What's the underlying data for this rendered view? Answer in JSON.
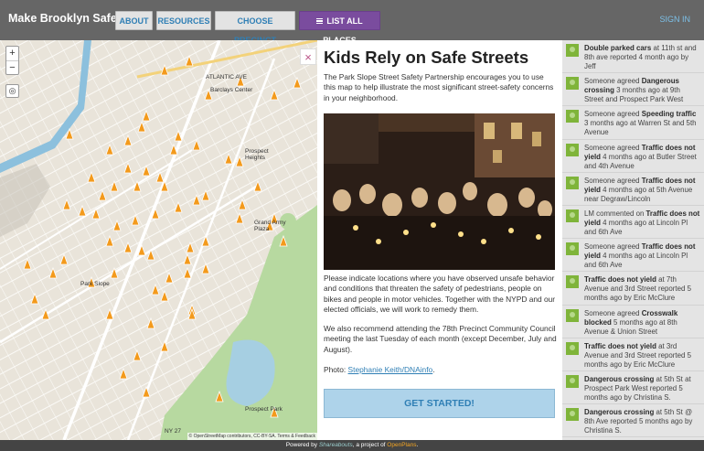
{
  "header": {
    "brand": "Make Brooklyn Safer",
    "nav": [
      "ABOUT",
      "RESOURCES",
      "CHOOSE PRECINCT",
      "LIST ALL PLACES"
    ],
    "signin": "SIGN IN"
  },
  "map": {
    "zoom_in": "+",
    "zoom_out": "−",
    "labels": [
      "ATLANTIC AVE",
      "Barclays Center",
      "Prospect Heights",
      "Grand Army Plaza",
      "Park Slope",
      "Prospect Park",
      "NY 27"
    ],
    "attribution": "© OpenStreetMap contributors, CC-BY-SA. Terms & Feedback"
  },
  "panel": {
    "close": "×",
    "title": "Kids Rely on Safe Streets",
    "intro": "The Park Slope Street Safety Partnership encourages you to use this map to help illustrate the most significant street-safety concerns in your neighborhood.",
    "body": "Please indicate locations where you have observed unsafe behavior and conditions that threaten the safety of pedestrians, people on bikes and people in motor vehicles. Together with the NYPD and our elected officials, we will work to remedy them.",
    "meeting": "We also recommend attending the 78th Precinct Community Council meeting the last Tuesday of each month (except December, July and August).",
    "photo_prefix": "Photo: ",
    "photo_credit": "Stephanie Keith/DNAinfo",
    "photo_suffix": ".",
    "cta": "GET STARTED!"
  },
  "activity": [
    {
      "bold1": "Double parked cars",
      "text1": " at 11th st and 8th ave reported 4 month ago by Jeff"
    },
    {
      "pre": "Someone agreed ",
      "bold1": "Dangerous crossing",
      "text1": " 3 months ago at 9th Street and Prospect Park West"
    },
    {
      "pre": "Someone agreed ",
      "bold1": "Speeding traffic",
      "text1": " 3 months ago at Warren St and 5th Avenue"
    },
    {
      "pre": "Someone agreed ",
      "bold1": "Traffic does not yield",
      "text1": " 4 months ago at Butler Street and 4th Avenue"
    },
    {
      "pre": "Someone agreed ",
      "bold1": "Traffic does not yield",
      "text1": " 4 months ago at 5th Avenue near Degraw/Lincoln"
    },
    {
      "pre": "LM commented on ",
      "bold1": "Traffic does not yield",
      "text1": " 4 months ago at Lincoln Pl and 6th Ave"
    },
    {
      "pre": "Someone agreed ",
      "bold1": "Traffic does not yield",
      "text1": " 4 months ago at Lincoln Pl and 6th Ave"
    },
    {
      "bold1": "Traffic does not yield",
      "text1": " at 7th Avenue and 3rd Street reported 5 months ago by Eric McClure"
    },
    {
      "pre": "Someone agreed ",
      "bold1": "Crosswalk blocked",
      "text1": " 5 months ago at 8th Avenue & Union Street"
    },
    {
      "bold1": "Traffic does not yield",
      "text1": " at 3rd Avenue and 3rd Street reported 5 months ago by Eric McClure"
    },
    {
      "bold1": "Dangerous crossing",
      "text1": " at 5th St at Prospect Park West reported 5 months ago by Christina S."
    },
    {
      "bold1": "Dangerous crossing",
      "text1": " at 5th St @ 8th Ave reported 5 months ago by Christina S."
    }
  ],
  "footer": {
    "pre": "Powered by ",
    "shareabouts": "Shareabouts",
    "mid": ", a project of ",
    "openplans": "OpenPlans",
    "post": "."
  }
}
